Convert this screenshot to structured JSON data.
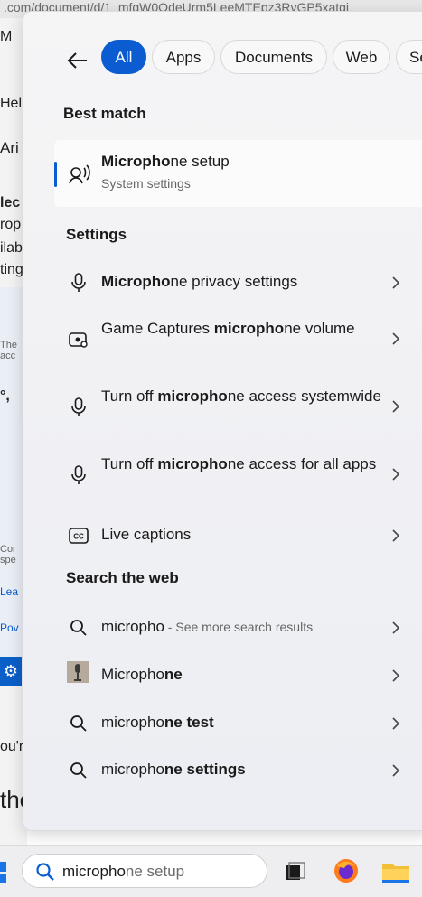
{
  "background": {
    "url_fragment": ".com/document/d/1_mfqW0OdeUrm5LeeMTEpz3RvGP5xatgj",
    "fragments": [
      "M",
      "Help",
      "Ari",
      "lec",
      "rop",
      "ilab",
      "ting",
      "The acc",
      "°,",
      "Cor spe",
      "Lea",
      "Pov",
      "ou'r",
      "the"
    ]
  },
  "panel": {
    "tabs": [
      {
        "label": "All",
        "active": true
      },
      {
        "label": "Apps",
        "active": false
      },
      {
        "label": "Documents",
        "active": false
      },
      {
        "label": "Web",
        "active": false
      },
      {
        "label": "Se",
        "active": false
      }
    ],
    "best_match_heading": "Best match",
    "best_match": {
      "title_bold": "Micropho",
      "title_rest": "ne setup",
      "subtitle": "System settings"
    },
    "settings_heading": "Settings",
    "settings": [
      {
        "icon": "microphone-icon",
        "parts": [
          {
            "t": "Micropho",
            "b": true
          },
          {
            "t": "ne privacy settings",
            "b": false
          }
        ]
      },
      {
        "icon": "game-capture-icon",
        "parts": [
          {
            "t": "Game Captures ",
            "b": false
          },
          {
            "t": "micropho",
            "b": true
          },
          {
            "t": "ne volume",
            "b": false
          }
        ]
      },
      {
        "icon": "microphone-icon",
        "parts": [
          {
            "t": "Turn off ",
            "b": false
          },
          {
            "t": "micropho",
            "b": true
          },
          {
            "t": "ne access systemwide",
            "b": false
          }
        ]
      },
      {
        "icon": "microphone-icon",
        "parts": [
          {
            "t": "Turn off ",
            "b": false
          },
          {
            "t": "micropho",
            "b": true
          },
          {
            "t": "ne access for all apps",
            "b": false
          }
        ]
      },
      {
        "icon": "captions-icon",
        "parts": [
          {
            "t": "Live captions",
            "b": false
          }
        ]
      }
    ],
    "web_heading": "Search the web",
    "web": [
      {
        "icon": "search-icon",
        "main": "micropho",
        "suffix": " - See more search results"
      },
      {
        "icon": "thumbnail-image",
        "parts": [
          {
            "t": "Micropho",
            "b": false
          },
          {
            "t": "ne",
            "b": true
          }
        ]
      },
      {
        "icon": "search-icon",
        "parts": [
          {
            "t": "micropho",
            "b": false
          },
          {
            "t": "ne test",
            "b": true
          }
        ]
      },
      {
        "icon": "search-icon",
        "parts": [
          {
            "t": "micropho",
            "b": false
          },
          {
            "t": "ne settings",
            "b": true
          }
        ]
      }
    ]
  },
  "taskbar": {
    "search_typed": "micropho",
    "search_suggestion": "ne setup"
  },
  "colors": {
    "accent": "#0b5cd1"
  }
}
